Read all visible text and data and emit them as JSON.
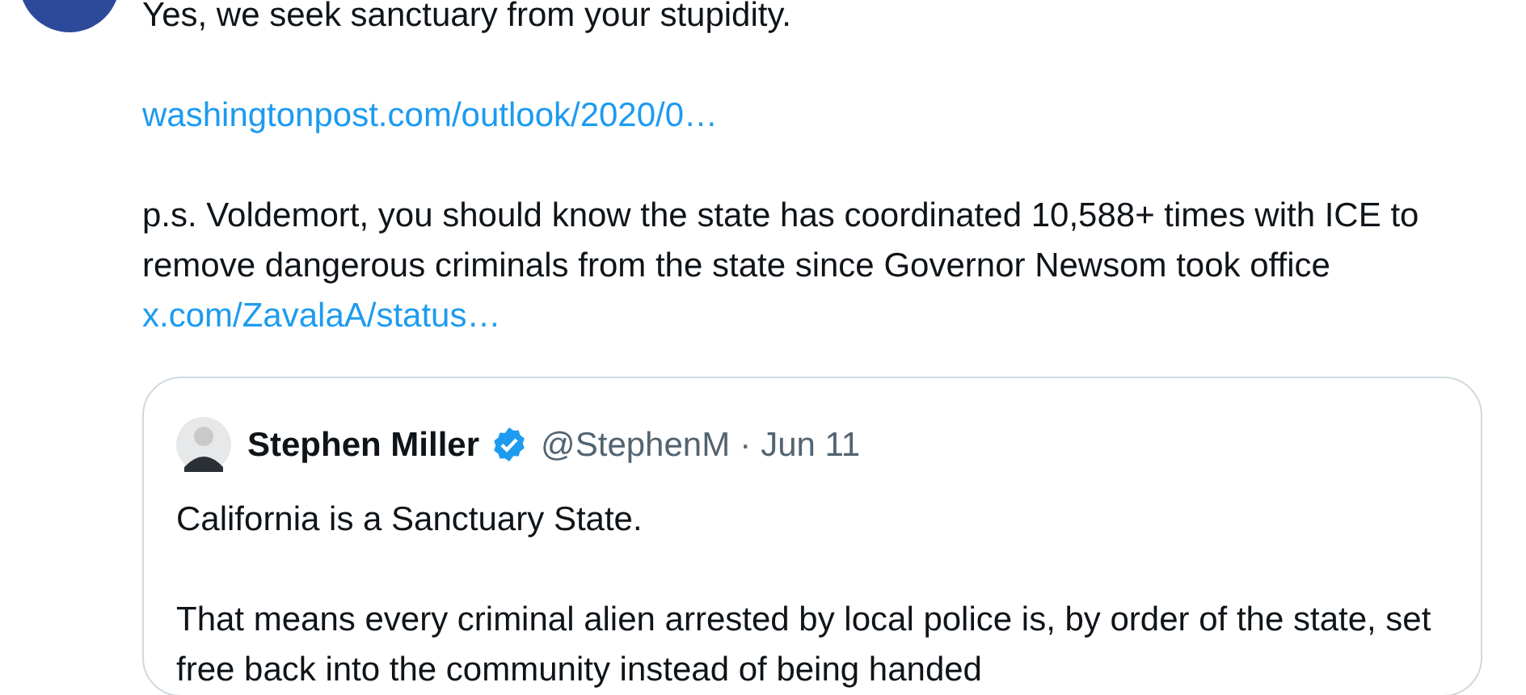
{
  "reply": {
    "text": "Yes, we seek sanctuary from your stupidity.",
    "link": "washingtonpost.com/outlook/2020/0…",
    "note": "p.s. Voldemort, you should know the state has coordinated 10,588+ times with ICE to remove dangerous criminals from the state since Governor Newsom took office",
    "note_link": "x.com/ZavalaA/status…"
  },
  "quote": {
    "name": "Stephen Miller",
    "verified": true,
    "handle": "@StephenM",
    "separator": "·",
    "date": "Jun 11",
    "paragraphs": [
      "California is a Sanctuary State.",
      "That means every criminal alien arrested by local police is, by order of the state, set free back into the community instead of being handed"
    ]
  }
}
